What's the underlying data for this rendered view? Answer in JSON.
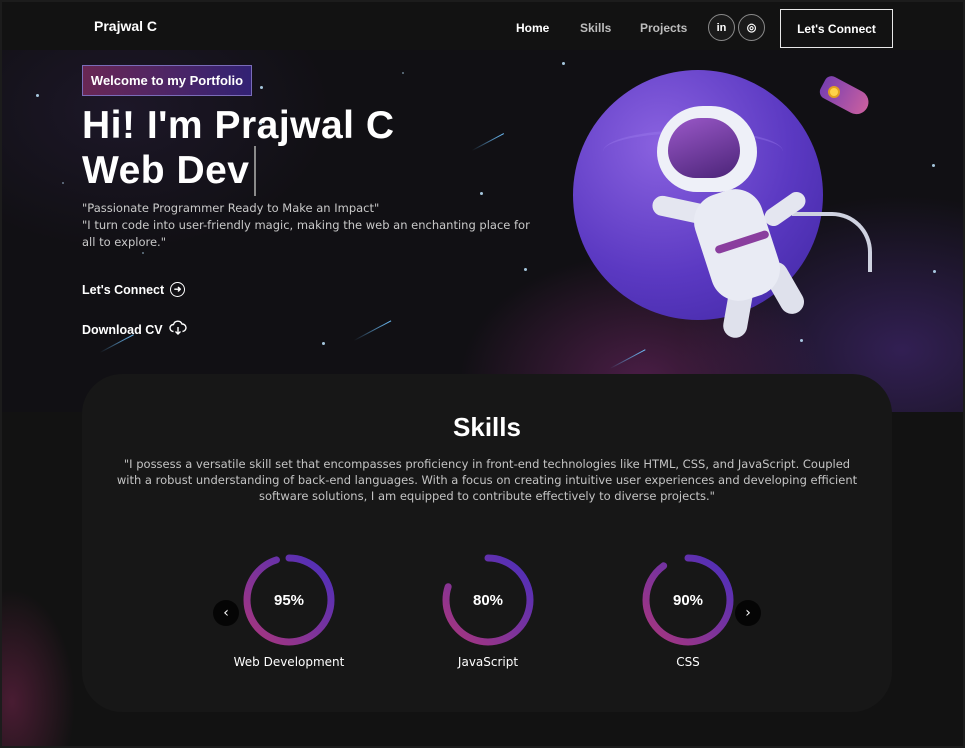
{
  "nav": {
    "brand": "Prajwal C",
    "links": [
      "Home",
      "Skills",
      "Projects"
    ],
    "social": [
      {
        "icon": "linkedin-icon",
        "glyph": "in"
      },
      {
        "icon": "instagram-icon",
        "glyph": "◎"
      }
    ],
    "connect_label": "Let's Connect"
  },
  "hero": {
    "tagline": "Welcome to my Portfolio",
    "headline_line1": "Hi! I'm Prajwal C",
    "headline_line2": "Web Dev",
    "description_line1": "\"Passionate Programmer Ready to Make an Impact\"",
    "description_line2": "\"I turn code into user-friendly magic, making the web an enchanting place for all to explore.\"",
    "cta_connect": "Let's Connect",
    "cta_connect_icon": "arrow-circle-right-icon",
    "cta_download": "Download CV",
    "cta_download_icon": "cloud-download-icon"
  },
  "skills": {
    "title": "Skills",
    "description": "\"I possess a versatile skill set that encompasses proficiency in front-end technologies like HTML, CSS, and JavaScript. Coupled with a robust understanding of back-end languages. With a focus on creating intuitive user experiences and developing efficient software solutions, I am equipped to contribute effectively to diverse projects.\"",
    "items": [
      {
        "label": "Web Development",
        "percent": "95%",
        "value": 95
      },
      {
        "label": "JavaScript",
        "percent": "80%",
        "value": 80
      },
      {
        "label": "CSS",
        "percent": "90%",
        "value": 90
      }
    ],
    "prev_glyph": "‹",
    "next_glyph": "›"
  },
  "colors": {
    "accent_pink": "#AA367C",
    "accent_purple": "#4A2FBD",
    "background": "#121212"
  }
}
